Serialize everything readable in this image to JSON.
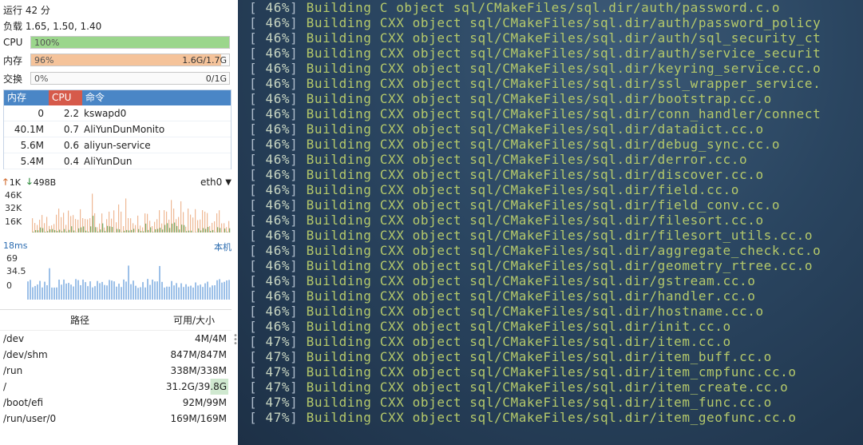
{
  "system": {
    "uptime": "运行 42 分",
    "load": "负载 1.65, 1.50, 1.40"
  },
  "meters": [
    {
      "label": "CPU",
      "percent_text": "100%",
      "value_text": "",
      "fill": 1.0,
      "color": "#9bd68c"
    },
    {
      "label": "内存",
      "percent_text": "96%",
      "value_text": "1.6G/1.7G",
      "fill": 0.96,
      "color": "#f5c39a"
    },
    {
      "label": "交换",
      "percent_text": "0%",
      "value_text": "0/1G",
      "fill": 0.0,
      "color": "#d8e8f5"
    }
  ],
  "processes": {
    "headers": {
      "mem": "内存",
      "cpu": "CPU",
      "cmd": "命令"
    },
    "rows": [
      {
        "mem": "0",
        "cpu": "2.2",
        "cmd": "kswapd0"
      },
      {
        "mem": "40.1M",
        "cpu": "0.7",
        "cmd": "AliYunDunMonito"
      },
      {
        "mem": "5.6M",
        "cpu": "0.6",
        "cmd": "aliyun-service"
      },
      {
        "mem": "5.4M",
        "cpu": "0.4",
        "cmd": "AliYunDun"
      }
    ]
  },
  "network": {
    "up_arrow": "🡑",
    "up": "1K",
    "down_arrow": "🡓",
    "down": "498B",
    "interface": "eth0",
    "caret": "▼",
    "y_ticks": [
      "46K",
      "32K",
      "16K"
    ],
    "colors": {
      "up": "#e8a070",
      "down": "#5aa050"
    }
  },
  "latency": {
    "current": "18ms",
    "host": "本机",
    "y_ticks": [
      "69",
      "34.5",
      "0"
    ],
    "color": "#9cc0e8"
  },
  "disks": {
    "headers": {
      "path": "路径",
      "avail": "可用/大小"
    },
    "rows": [
      {
        "path": "/dev",
        "avail": "4M/4M"
      },
      {
        "path": "/dev/shm",
        "avail": "847M/847M"
      },
      {
        "path": "/run",
        "avail": "338M/338M"
      },
      {
        "path": "/",
        "avail": "31.2G/39.8G"
      },
      {
        "path": "/boot/efi",
        "avail": "92M/99M"
      },
      {
        "path": "/run/user/0",
        "avail": "169M/169M"
      }
    ]
  },
  "terminal": {
    "lines": [
      {
        "pct": " 46%",
        "text": "Building C object sql/CMakeFiles/sql.dir/auth/password.c.o"
      },
      {
        "pct": " 46%",
        "text": "Building CXX object sql/CMakeFiles/sql.dir/auth/password_policy"
      },
      {
        "pct": " 46%",
        "text": "Building CXX object sql/CMakeFiles/sql.dir/auth/sql_security_ct"
      },
      {
        "pct": " 46%",
        "text": "Building CXX object sql/CMakeFiles/sql.dir/auth/service_securit"
      },
      {
        "pct": " 46%",
        "text": "Building CXX object sql/CMakeFiles/sql.dir/keyring_service.cc.o"
      },
      {
        "pct": " 46%",
        "text": "Building CXX object sql/CMakeFiles/sql.dir/ssl_wrapper_service."
      },
      {
        "pct": " 46%",
        "text": "Building CXX object sql/CMakeFiles/sql.dir/bootstrap.cc.o"
      },
      {
        "pct": " 46%",
        "text": "Building CXX object sql/CMakeFiles/sql.dir/conn_handler/connect"
      },
      {
        "pct": " 46%",
        "text": "Building CXX object sql/CMakeFiles/sql.dir/datadict.cc.o"
      },
      {
        "pct": " 46%",
        "text": "Building CXX object sql/CMakeFiles/sql.dir/debug_sync.cc.o"
      },
      {
        "pct": " 46%",
        "text": "Building CXX object sql/CMakeFiles/sql.dir/derror.cc.o"
      },
      {
        "pct": " 46%",
        "text": "Building CXX object sql/CMakeFiles/sql.dir/discover.cc.o"
      },
      {
        "pct": " 46%",
        "text": "Building CXX object sql/CMakeFiles/sql.dir/field.cc.o"
      },
      {
        "pct": " 46%",
        "text": "Building CXX object sql/CMakeFiles/sql.dir/field_conv.cc.o"
      },
      {
        "pct": " 46%",
        "text": "Building CXX object sql/CMakeFiles/sql.dir/filesort.cc.o"
      },
      {
        "pct": " 46%",
        "text": "Building CXX object sql/CMakeFiles/sql.dir/filesort_utils.cc.o"
      },
      {
        "pct": " 46%",
        "text": "Building CXX object sql/CMakeFiles/sql.dir/aggregate_check.cc.o"
      },
      {
        "pct": " 46%",
        "text": "Building CXX object sql/CMakeFiles/sql.dir/geometry_rtree.cc.o"
      },
      {
        "pct": " 46%",
        "text": "Building CXX object sql/CMakeFiles/sql.dir/gstream.cc.o"
      },
      {
        "pct": " 46%",
        "text": "Building CXX object sql/CMakeFiles/sql.dir/handler.cc.o"
      },
      {
        "pct": " 46%",
        "text": "Building CXX object sql/CMakeFiles/sql.dir/hostname.cc.o"
      },
      {
        "pct": " 46%",
        "text": "Building CXX object sql/CMakeFiles/sql.dir/init.cc.o"
      },
      {
        "pct": " 47%",
        "text": "Building CXX object sql/CMakeFiles/sql.dir/item.cc.o"
      },
      {
        "pct": " 47%",
        "text": "Building CXX object sql/CMakeFiles/sql.dir/item_buff.cc.o"
      },
      {
        "pct": " 47%",
        "text": "Building CXX object sql/CMakeFiles/sql.dir/item_cmpfunc.cc.o"
      },
      {
        "pct": " 47%",
        "text": "Building CXX object sql/CMakeFiles/sql.dir/item_create.cc.o"
      },
      {
        "pct": " 47%",
        "text": "Building CXX object sql/CMakeFiles/sql.dir/item_func.cc.o"
      },
      {
        "pct": " 47%",
        "text": "Building CXX object sql/CMakeFiles/sql.dir/item_geofunc.cc.o"
      }
    ],
    "colors": {
      "bracket": "#aebccb",
      "text": "#b5c96a",
      "background": "#2a4560"
    }
  }
}
